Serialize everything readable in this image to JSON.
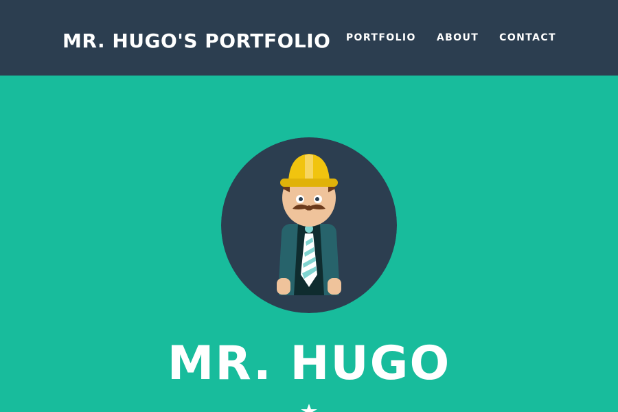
{
  "nav": {
    "brand": "MR. HUGO'S PORTFOLIO",
    "links": [
      {
        "label": "PORTFOLIO"
      },
      {
        "label": "ABOUT"
      },
      {
        "label": "CONTACT"
      }
    ]
  },
  "hero": {
    "title": "MR. HUGO",
    "avatar_icon": "construction-worker-avatar",
    "divider_icon": "star-icon"
  },
  "colors": {
    "navbar": "#2c3e50",
    "hero_bg": "#18bc9c",
    "avatar_bg": "#2c3e50",
    "text": "#ffffff",
    "helmet": "#f1c40f"
  }
}
